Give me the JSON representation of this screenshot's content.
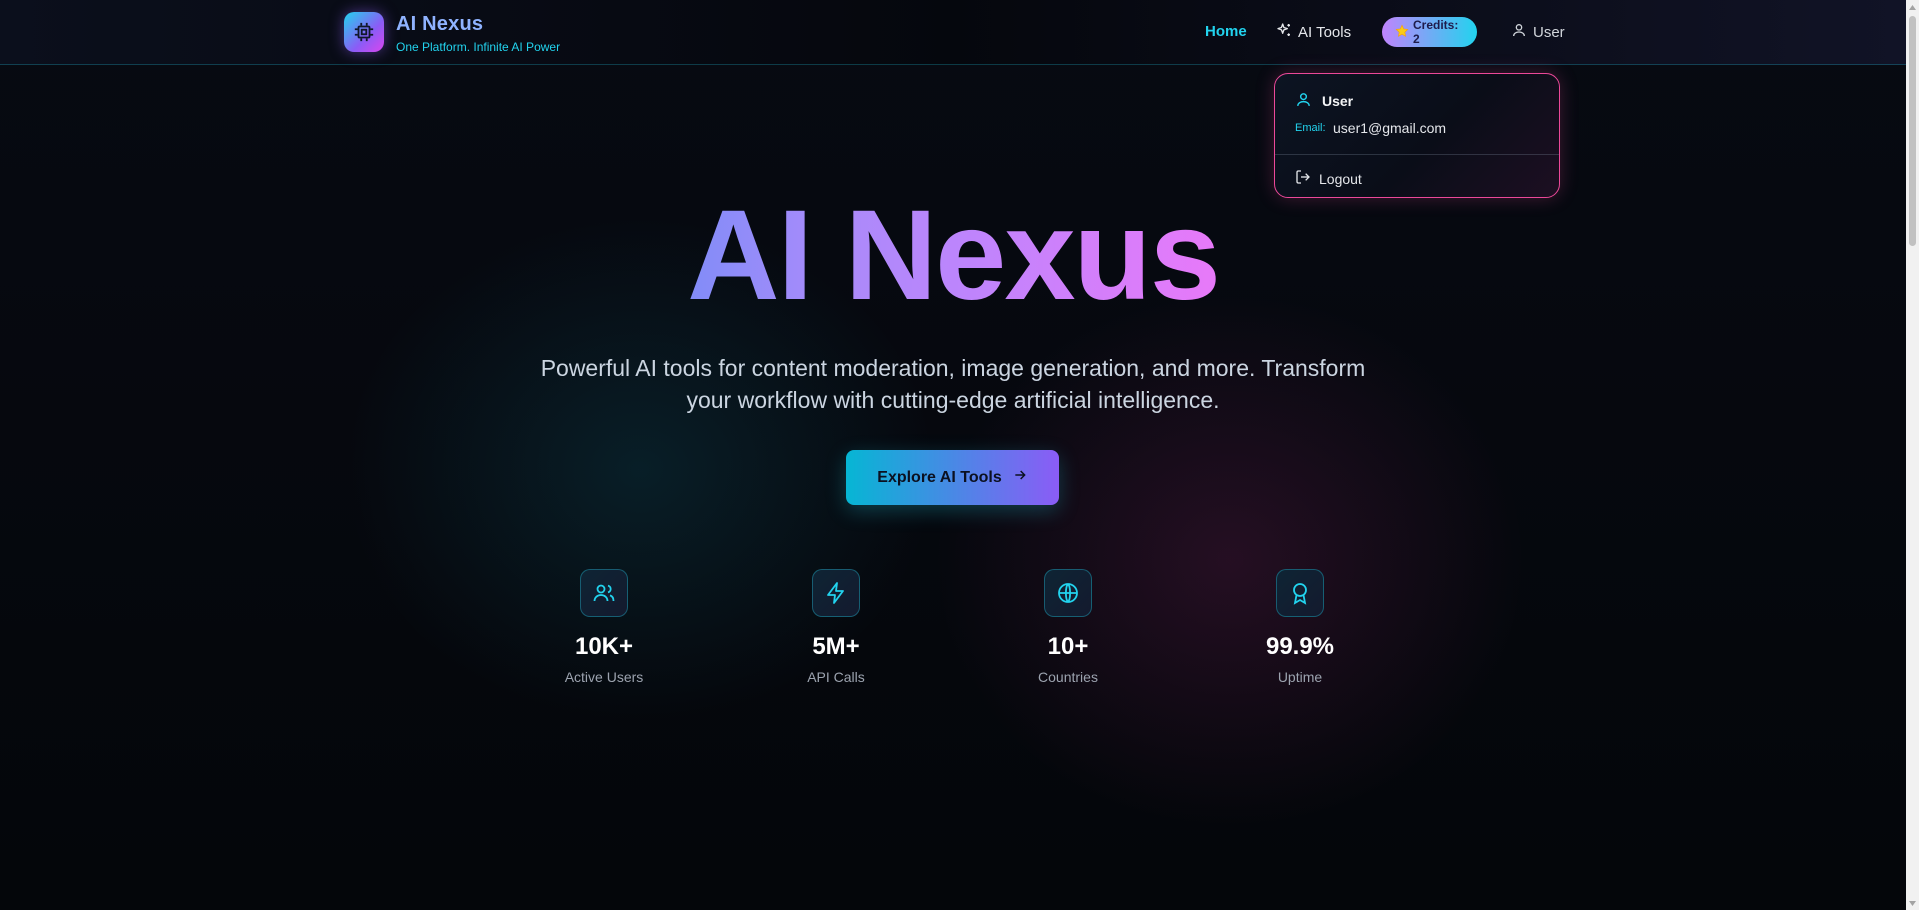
{
  "brand": {
    "name": "AI Nexus",
    "tagline": "One Platform. Infinite AI Power"
  },
  "nav": {
    "home": "Home",
    "ai_tools": "AI Tools",
    "credits": "Credits: 2",
    "user": "User"
  },
  "dropdown": {
    "username": "User",
    "email_label": "Email:",
    "email": "user1@gmail.com",
    "logout": "Logout"
  },
  "hero": {
    "title": "AI Nexus",
    "subtitle_line1": "Powerful AI tools for content moderation, image generation, and more. Transform",
    "subtitle_line2": "your workflow with cutting-edge artificial intelligence.",
    "cta": "Explore AI Tools"
  },
  "stats": [
    {
      "value": "10K+",
      "label": "Active Users",
      "icon": "users-icon"
    },
    {
      "value": "5M+",
      "label": "API Calls",
      "icon": "lightning-icon"
    },
    {
      "value": "10+",
      "label": "Countries",
      "icon": "globe-icon"
    },
    {
      "value": "99.9%",
      "label": "Uptime",
      "icon": "award-icon"
    }
  ],
  "colors": {
    "accent_cyan": "#22d3ee",
    "accent_purple": "#8b5cf6",
    "accent_pink": "#ec4899",
    "background": "#05070c"
  }
}
